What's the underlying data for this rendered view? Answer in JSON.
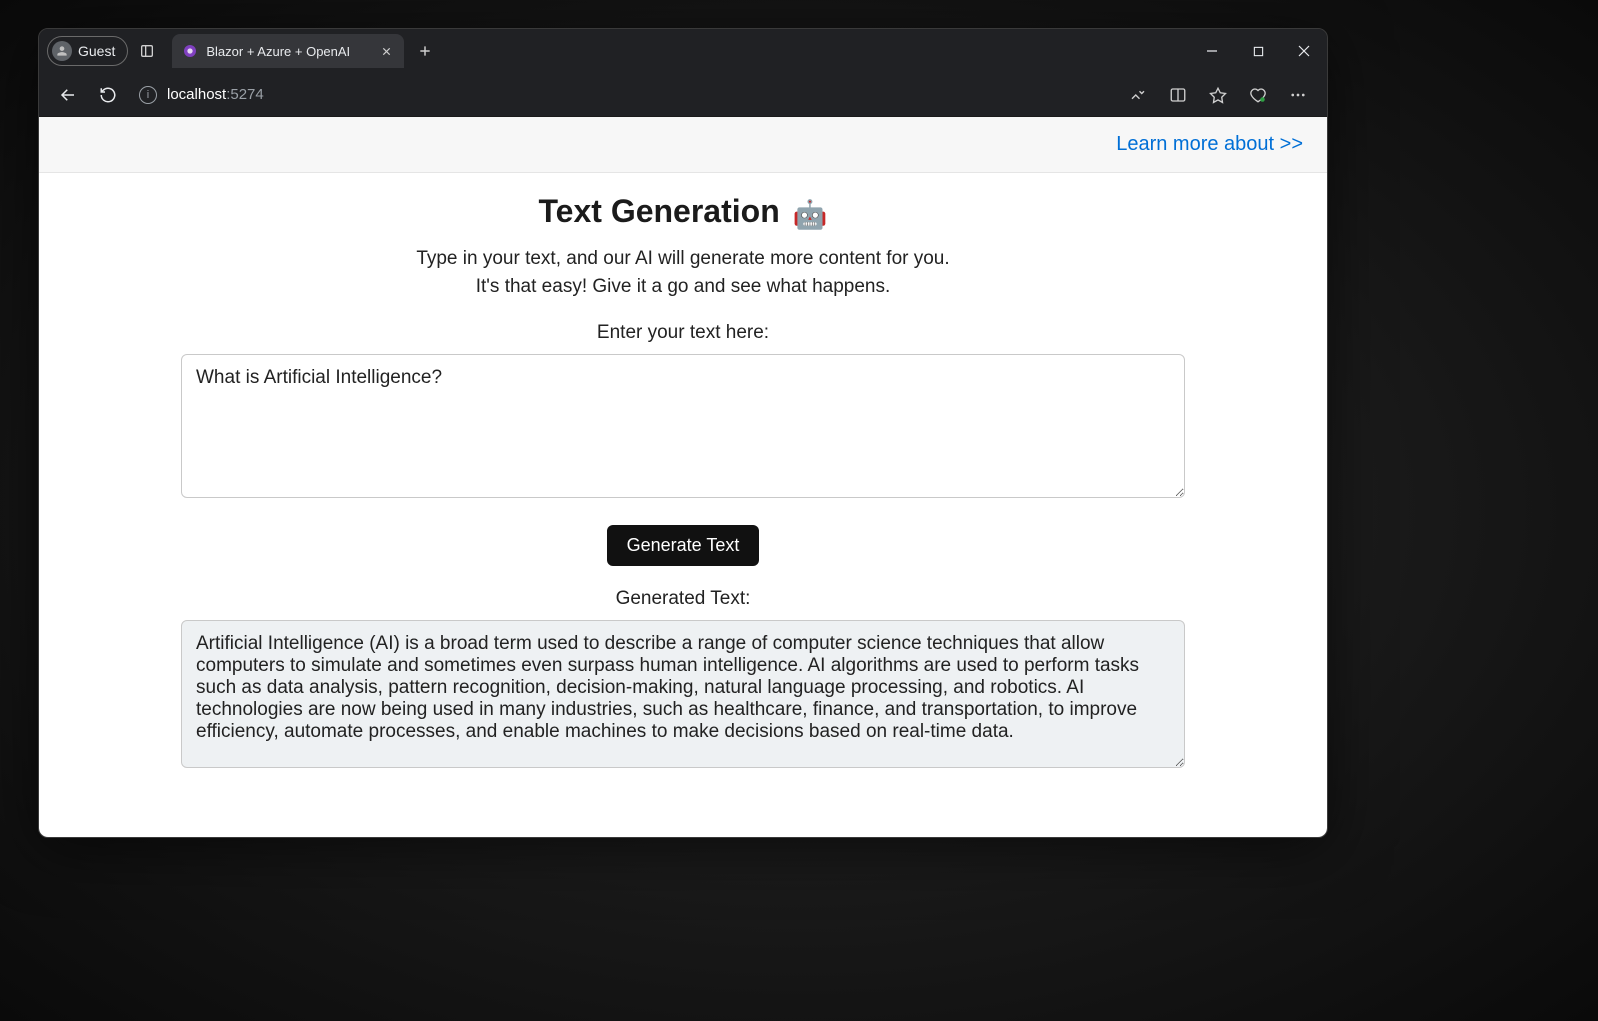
{
  "browser": {
    "profile_label": "Guest",
    "tab_title": "Blazor + Azure + OpenAI",
    "url_host": "localhost",
    "url_port": ":5274"
  },
  "header": {
    "learn_more": "Learn more about >>"
  },
  "page": {
    "title": "Text Generation ",
    "robot_icon": "🤖",
    "subtitle_line1": "Type in your text, and our AI will generate more content for you.",
    "subtitle_line2": "It's that easy! Give it a go and see what happens.",
    "input_label": "Enter your text here:",
    "input_value": "What is Artificial Intelligence?",
    "generate_button": "Generate Text",
    "output_label": "Generated Text:",
    "output_value": "Artificial Intelligence (AI) is a broad term used to describe a range of computer science techniques that allow computers to simulate and sometimes even surpass human intelligence. AI algorithms are used to perform tasks such as data analysis, pattern recognition, decision-making, natural language processing, and robotics. AI technologies are now being used in many industries, such as healthcare, finance, and transportation, to improve efficiency, automate processes, and enable machines to make decisions based on real-time data."
  }
}
